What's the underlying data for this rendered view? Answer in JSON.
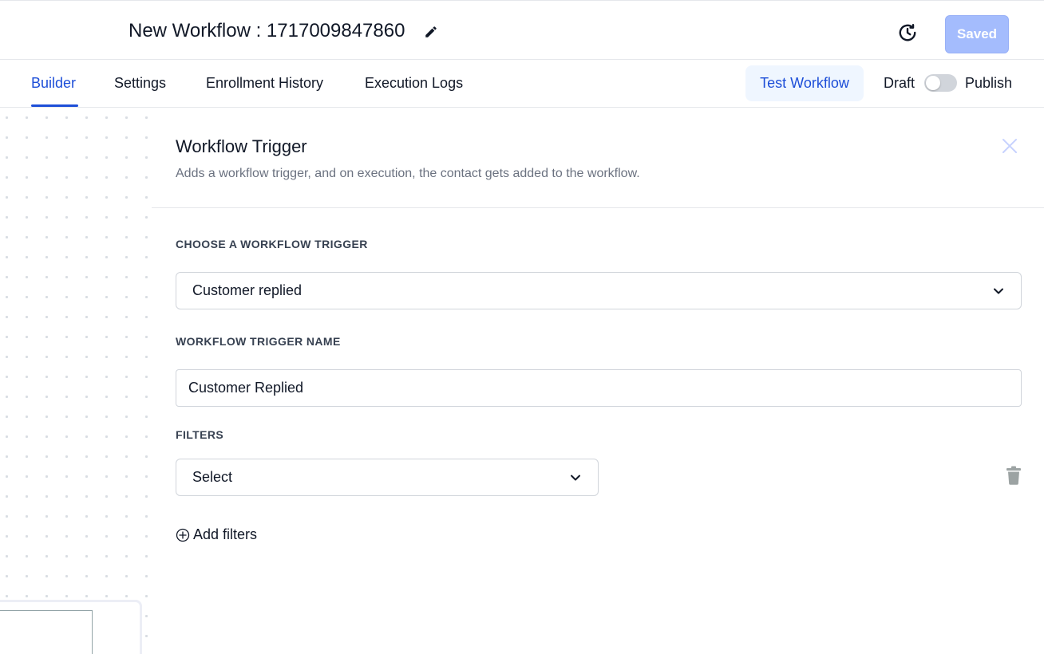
{
  "header": {
    "title": "New Workflow : 1717009847860",
    "edit_icon": "pencil-icon",
    "history_icon": "history-clock-icon",
    "saved_label": "Saved"
  },
  "tabs": {
    "items": [
      {
        "label": "Builder",
        "active": true
      },
      {
        "label": "Settings",
        "active": false
      },
      {
        "label": "Enrollment History",
        "active": false
      },
      {
        "label": "Execution Logs",
        "active": false
      }
    ],
    "test_workflow_label": "Test Workflow",
    "draft_label": "Draft",
    "publish_label": "Publish",
    "publish_toggle_on": false
  },
  "panel": {
    "title": "Workflow Trigger",
    "subtitle": "Adds a workflow trigger, and on execution, the contact gets added to the workflow.",
    "choose_trigger_label": "CHOOSE A WORKFLOW TRIGGER",
    "trigger_selected": "Customer replied",
    "trigger_name_label": "WORKFLOW TRIGGER NAME",
    "trigger_name_value": "Customer Replied",
    "filters_label": "FILTERS",
    "filter_select_value": "Select",
    "add_filters_label": "Add filters"
  },
  "colors": {
    "accent": "#1d4ed8",
    "saved_button": "#a4bcfd",
    "test_button_bg": "#eff6ff",
    "toggle_off": "#d1d5db"
  }
}
